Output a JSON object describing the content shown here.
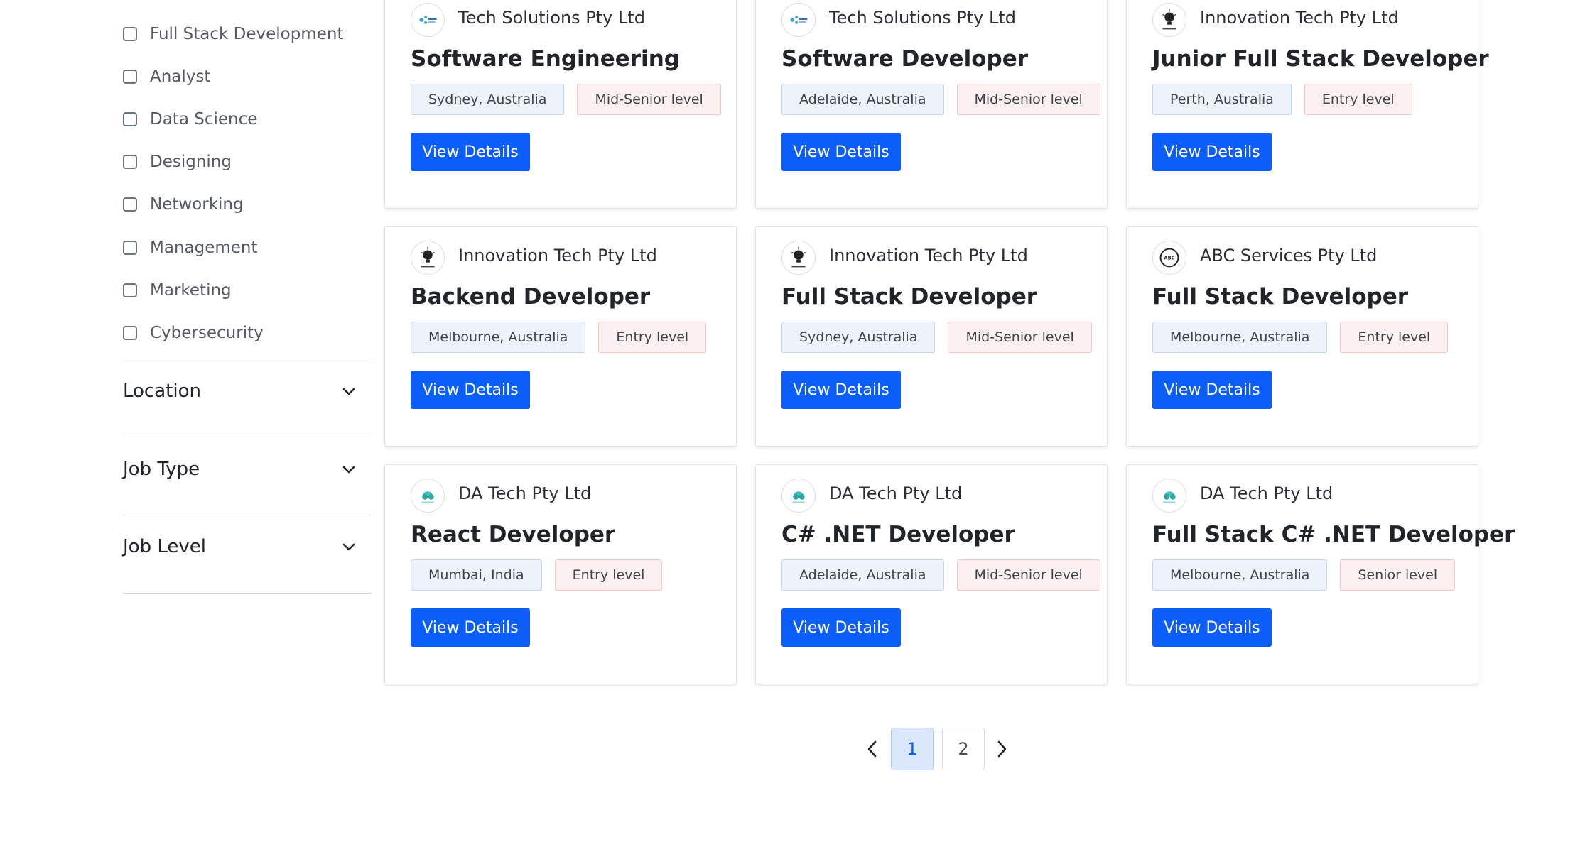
{
  "sidebar": {
    "categories": [
      "Full Stack Development",
      "Analyst",
      "Data Science",
      "Designing",
      "Networking",
      "Management",
      "Marketing",
      "Cybersecurity"
    ],
    "filters": [
      "Location",
      "Job Type",
      "Job Level"
    ]
  },
  "jobs": [
    {
      "company": "Tech Solutions Pty Ltd",
      "logo": "tech-logo",
      "title": "Software Engineering",
      "location": "Sydney, Australia",
      "level": "Mid-Senior level",
      "button": "View Details"
    },
    {
      "company": "Tech Solutions Pty Ltd",
      "logo": "tech-logo",
      "title": "Software Developer",
      "location": "Adelaide, Australia",
      "level": "Mid-Senior level",
      "button": "View Details"
    },
    {
      "company": "Innovation Tech Pty Ltd",
      "logo": "bulb-logo",
      "title": "Junior Full Stack Developer",
      "location": "Perth, Australia",
      "level": "Entry level",
      "button": "View Details"
    },
    {
      "company": "Innovation Tech Pty Ltd",
      "logo": "bulb-logo",
      "title": "Backend Developer",
      "location": "Melbourne, Australia",
      "level": "Entry level",
      "button": "View Details"
    },
    {
      "company": "Innovation Tech Pty Ltd",
      "logo": "bulb-logo",
      "title": "Full Stack Developer",
      "location": "Sydney, Australia",
      "level": "Mid-Senior level",
      "button": "View Details"
    },
    {
      "company": "ABC Services Pty Ltd",
      "logo": "abc-logo",
      "title": "Full Stack Developer",
      "location": "Melbourne, Australia",
      "level": "Entry level",
      "button": "View Details"
    },
    {
      "company": "DA Tech Pty Ltd",
      "logo": "da-logo",
      "title": "React Developer",
      "location": "Mumbai, India",
      "level": "Entry level",
      "button": "View Details"
    },
    {
      "company": "DA Tech Pty Ltd",
      "logo": "da-logo",
      "title": "C# .NET Developer",
      "location": "Adelaide, Australia",
      "level": "Mid-Senior level",
      "button": "View Details"
    },
    {
      "company": "DA Tech Pty Ltd",
      "logo": "da-logo",
      "title": "Full Stack C# .NET Developer",
      "location": "Melbourne, Australia",
      "level": "Senior level",
      "button": "View Details"
    }
  ],
  "pagination": {
    "pages": [
      "1",
      "2"
    ],
    "current": "1"
  },
  "colors": {
    "primary": "#0b5ef9",
    "location_badge": "#eef3fb",
    "level_badge": "#fdf0f0",
    "page_active": "#dbe8fb"
  }
}
